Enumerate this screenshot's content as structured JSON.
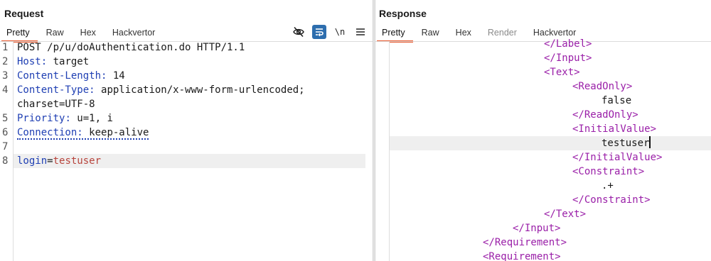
{
  "request": {
    "title": "Request",
    "tabs": [
      {
        "label": "Pretty",
        "active": true
      },
      {
        "label": "Raw"
      },
      {
        "label": "Hex"
      },
      {
        "label": "Hackvertor"
      }
    ],
    "toolbar": {
      "hide_icon": "eye-slash-icon",
      "wrap_icon": "word-wrap-icon",
      "newline_label": "\\n",
      "menu_icon": "hamburger-menu-icon"
    },
    "line_numbers": [
      "1",
      "2",
      "3",
      "4",
      "5",
      "6",
      "7",
      "8"
    ],
    "request_line": "POST /p/u/doAuthentication.do HTTP/1.1",
    "headers": [
      {
        "name": "Host",
        "value": " target"
      },
      {
        "name": "Content-Length",
        "value": " 14"
      },
      {
        "name": "Content-Type",
        "value": " application/x-www-form-urlencoded;"
      },
      {
        "name": "Priority",
        "value": " u=1, i"
      },
      {
        "name": "Connection",
        "value": " keep-alive"
      }
    ],
    "content_type_cont": "charset=UTF-8",
    "separator": ":",
    "body": {
      "param": "login",
      "eq": "=",
      "value": "testuser"
    }
  },
  "response": {
    "title": "Response",
    "tabs": [
      {
        "label": "Pretty",
        "active": true
      },
      {
        "label": "Raw"
      },
      {
        "label": "Hex"
      },
      {
        "label": "Render",
        "disabled": true
      },
      {
        "label": "Hackvertor"
      }
    ],
    "lines": [
      {
        "text": "</Label>",
        "kind": "close"
      },
      {
        "text": "</Input>",
        "kind": "close"
      },
      {
        "text": "<Text>",
        "kind": "open"
      },
      {
        "text": "<ReadOnly>",
        "kind": "open"
      },
      {
        "text": "false",
        "kind": "text"
      },
      {
        "text": "</ReadOnly>",
        "kind": "close"
      },
      {
        "text": "<InitialValue>",
        "kind": "open"
      },
      {
        "text": "testuser",
        "kind": "text"
      },
      {
        "text": "</InitialValue>",
        "kind": "close"
      },
      {
        "text": "<Constraint>",
        "kind": "open"
      },
      {
        "text": ".+",
        "kind": "text"
      },
      {
        "text": "</Constraint>",
        "kind": "close"
      },
      {
        "text": "</Text>",
        "kind": "close"
      },
      {
        "text": "</Input>",
        "kind": "close"
      },
      {
        "text": "</Requirement>",
        "kind": "close"
      },
      {
        "text": "<Requirement>",
        "kind": "open"
      }
    ]
  }
}
